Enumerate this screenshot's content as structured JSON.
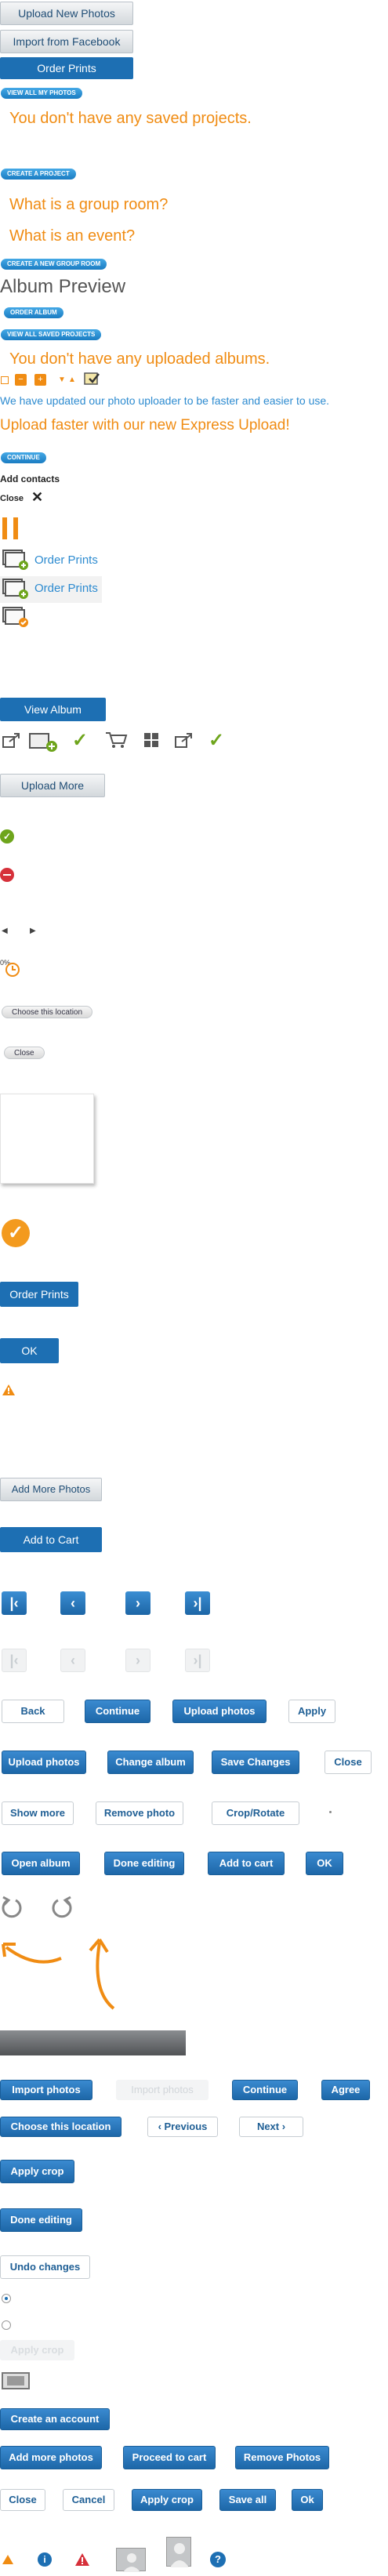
{
  "top_buttons": {
    "upload_new_photos": "Upload New Photos",
    "import_facebook": "Import from Facebook",
    "order_prints": "Order Prints"
  },
  "pills": {
    "view_all_photos": "VIEW ALL MY PHOTOS",
    "create_project": "CREATE A PROJECT",
    "create_group_room": "CREATE A NEW GROUP ROOM",
    "order_album": "ORDER ALBUM",
    "view_saved_projects": "VIEW ALL SAVED PROJECTS",
    "continue": "CONTINUE"
  },
  "messages": {
    "no_projects": "You don't have any saved projects.",
    "group_room": "What is a group room?",
    "event": "What is an event?",
    "album_preview": "Album Preview",
    "no_albums": "You don't have any uploaded albums.",
    "uploader_update": "We have updated our photo uploader to be faster and easier to use.",
    "express_upload": "Upload faster with our new Express Upload!",
    "add_contacts": "Add contacts",
    "close": "Close"
  },
  "photo_rows": {
    "order_prints_1": "Order Prints",
    "order_prints_2": "Order Prints"
  },
  "buttons_mid": {
    "view_album": "View Album",
    "upload_more": "Upload More",
    "choose_location": "Choose this location",
    "close_small": "Close",
    "order_prints": "Order Prints",
    "ok": "OK",
    "add_more_photos": "Add More Photos",
    "add_to_cart": "Add to Cart"
  },
  "misc": {
    "pct_label": "0%"
  },
  "button_rows": {
    "row1": [
      "Back",
      "Continue",
      "Upload photos",
      "Apply"
    ],
    "row2": [
      "Upload photos",
      "Change album",
      "Save Changes",
      "Close"
    ],
    "row3": [
      "Show more",
      "Remove photo",
      "Crop/Rotate"
    ],
    "row4": [
      "Open album",
      "Done editing",
      "Add to cart",
      "OK"
    ]
  },
  "lower_buttons": {
    "import_photos": "Import photos",
    "import_photos_disabled": "Import photos",
    "continue": "Continue",
    "agree": "Agree",
    "choose_location": "Choose this location",
    "previous": "‹ Previous",
    "next": "Next ›",
    "apply_crop": "Apply crop",
    "done_editing": "Done editing",
    "undo_changes": "Undo changes",
    "apply_crop_disabled": "Apply crop",
    "create_account": "Create an account",
    "add_more_photos": "Add more photos",
    "proceed_to_cart": "Proceed to cart",
    "remove_photos": "Remove Photos",
    "close": "Close",
    "cancel": "Cancel",
    "apply_crop_2": "Apply crop",
    "save_all": "Save all",
    "ok": "Ok"
  },
  "colors": {
    "brand_blue": "#1d6fb3",
    "orange": "#f08c13",
    "light_blue": "#2d8bd0",
    "green": "#6ea51c",
    "red": "#d6303a"
  }
}
